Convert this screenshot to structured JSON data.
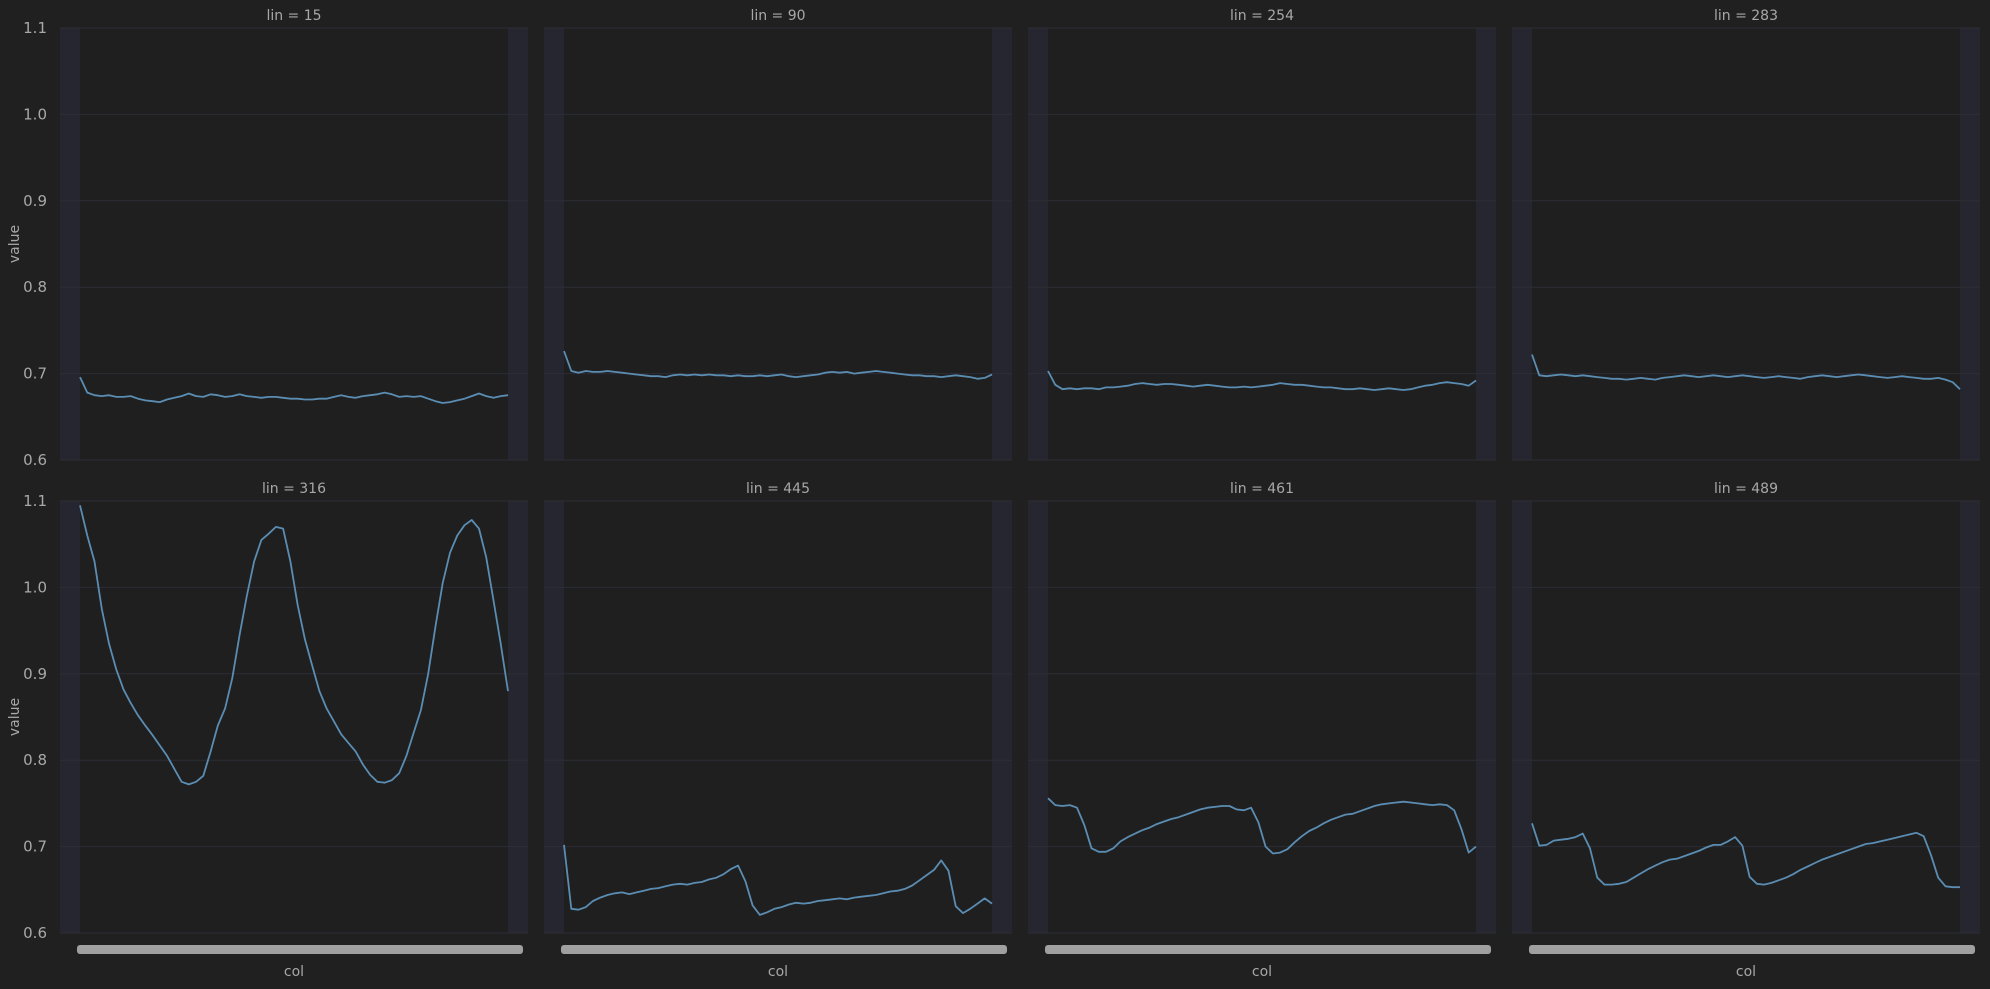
{
  "colors": {
    "background": "#202020",
    "panel": "#1f1f1f",
    "band": "#262630",
    "grid": "#2d2d36",
    "line": "#5b8db3",
    "text": "#a8a8a8",
    "xtick_overlap": "#a0a0a0"
  },
  "chart_data": {
    "type": "line",
    "layout": "facet grid, 2 rows x 4 columns, shared y axis",
    "xlabel": "col",
    "ylabel": "value",
    "ylim": [
      0.6,
      1.1
    ],
    "yticks": [
      "0.6",
      "0.7",
      "0.8",
      "0.9",
      "1.0",
      "1.1"
    ],
    "x_range": [
      0,
      1
    ],
    "x_ticks_note": "x tick labels are so dense they overlap into a solid grey band",
    "grid": true,
    "panels": [
      {
        "title": "lin = 15",
        "y": [
          0.696,
          0.678,
          0.675,
          0.674,
          0.675,
          0.673,
          0.673,
          0.674,
          0.671,
          0.669,
          0.668,
          0.667,
          0.67,
          0.672,
          0.674,
          0.677,
          0.674,
          0.673,
          0.676,
          0.675,
          0.673,
          0.674,
          0.676,
          0.674,
          0.673,
          0.672,
          0.673,
          0.673,
          0.672,
          0.671,
          0.671,
          0.67,
          0.67,
          0.671,
          0.671,
          0.673,
          0.675,
          0.673,
          0.672,
          0.674,
          0.675,
          0.676,
          0.678,
          0.676,
          0.673,
          0.674,
          0.673,
          0.674,
          0.671,
          0.668,
          0.666,
          0.667,
          0.669,
          0.671,
          0.674,
          0.677,
          0.674,
          0.672,
          0.674,
          0.675
        ]
      },
      {
        "title": "lin = 90",
        "y": [
          0.726,
          0.703,
          0.701,
          0.703,
          0.702,
          0.702,
          0.703,
          0.702,
          0.701,
          0.7,
          0.699,
          0.698,
          0.697,
          0.697,
          0.696,
          0.698,
          0.699,
          0.698,
          0.699,
          0.698,
          0.699,
          0.698,
          0.698,
          0.697,
          0.698,
          0.697,
          0.697,
          0.698,
          0.697,
          0.698,
          0.699,
          0.697,
          0.696,
          0.697,
          0.698,
          0.699,
          0.701,
          0.702,
          0.701,
          0.702,
          0.7,
          0.701,
          0.702,
          0.703,
          0.702,
          0.701,
          0.7,
          0.699,
          0.698,
          0.698,
          0.697,
          0.697,
          0.696,
          0.697,
          0.698,
          0.697,
          0.696,
          0.694,
          0.695,
          0.699
        ]
      },
      {
        "title": "lin = 254",
        "y": [
          0.703,
          0.687,
          0.682,
          0.683,
          0.682,
          0.683,
          0.683,
          0.682,
          0.684,
          0.684,
          0.685,
          0.686,
          0.688,
          0.689,
          0.688,
          0.687,
          0.688,
          0.688,
          0.687,
          0.686,
          0.685,
          0.686,
          0.687,
          0.686,
          0.685,
          0.684,
          0.684,
          0.685,
          0.684,
          0.685,
          0.686,
          0.687,
          0.689,
          0.688,
          0.687,
          0.687,
          0.686,
          0.685,
          0.684,
          0.684,
          0.683,
          0.682,
          0.682,
          0.683,
          0.682,
          0.681,
          0.682,
          0.683,
          0.682,
          0.681,
          0.682,
          0.684,
          0.686,
          0.687,
          0.689,
          0.69,
          0.689,
          0.688,
          0.686,
          0.692
        ]
      },
      {
        "title": "lin = 283",
        "y": [
          0.722,
          0.698,
          0.697,
          0.698,
          0.699,
          0.698,
          0.697,
          0.698,
          0.697,
          0.696,
          0.695,
          0.694,
          0.694,
          0.693,
          0.694,
          0.695,
          0.694,
          0.693,
          0.695,
          0.696,
          0.697,
          0.698,
          0.697,
          0.696,
          0.697,
          0.698,
          0.697,
          0.696,
          0.697,
          0.698,
          0.697,
          0.696,
          0.695,
          0.696,
          0.697,
          0.696,
          0.695,
          0.694,
          0.696,
          0.697,
          0.698,
          0.697,
          0.696,
          0.697,
          0.698,
          0.699,
          0.698,
          0.697,
          0.696,
          0.695,
          0.696,
          0.697,
          0.696,
          0.695,
          0.694,
          0.694,
          0.695,
          0.693,
          0.69,
          0.682
        ]
      },
      {
        "title": "lin = 316",
        "y": [
          1.095,
          1.06,
          1.03,
          0.975,
          0.935,
          0.905,
          0.882,
          0.866,
          0.852,
          0.84,
          0.829,
          0.817,
          0.805,
          0.79,
          0.775,
          0.772,
          0.775,
          0.782,
          0.81,
          0.84,
          0.86,
          0.895,
          0.945,
          0.99,
          1.03,
          1.055,
          1.062,
          1.07,
          1.068,
          1.03,
          0.98,
          0.94,
          0.91,
          0.88,
          0.86,
          0.845,
          0.83,
          0.82,
          0.81,
          0.795,
          0.783,
          0.775,
          0.774,
          0.777,
          0.785,
          0.805,
          0.832,
          0.858,
          0.9,
          0.955,
          1.005,
          1.04,
          1.06,
          1.072,
          1.078,
          1.068,
          1.035,
          0.985,
          0.935,
          0.88
        ]
      },
      {
        "title": "lin = 445",
        "y": [
          0.702,
          0.628,
          0.627,
          0.63,
          0.637,
          0.641,
          0.644,
          0.646,
          0.647,
          0.645,
          0.647,
          0.649,
          0.651,
          0.652,
          0.654,
          0.656,
          0.657,
          0.656,
          0.658,
          0.659,
          0.662,
          0.664,
          0.668,
          0.674,
          0.678,
          0.66,
          0.632,
          0.621,
          0.624,
          0.628,
          0.63,
          0.633,
          0.635,
          0.634,
          0.635,
          0.637,
          0.638,
          0.639,
          0.64,
          0.639,
          0.641,
          0.642,
          0.643,
          0.644,
          0.646,
          0.648,
          0.649,
          0.651,
          0.655,
          0.661,
          0.667,
          0.673,
          0.684,
          0.672,
          0.631,
          0.623,
          0.628,
          0.634,
          0.64,
          0.634
        ]
      },
      {
        "title": "lin = 461",
        "y": [
          0.756,
          0.748,
          0.747,
          0.748,
          0.745,
          0.725,
          0.698,
          0.694,
          0.694,
          0.698,
          0.706,
          0.711,
          0.715,
          0.719,
          0.722,
          0.726,
          0.729,
          0.732,
          0.734,
          0.737,
          0.74,
          0.743,
          0.745,
          0.746,
          0.747,
          0.747,
          0.743,
          0.742,
          0.745,
          0.728,
          0.7,
          0.692,
          0.693,
          0.697,
          0.705,
          0.712,
          0.718,
          0.722,
          0.727,
          0.731,
          0.734,
          0.737,
          0.738,
          0.741,
          0.744,
          0.747,
          0.749,
          0.75,
          0.751,
          0.752,
          0.751,
          0.75,
          0.749,
          0.748,
          0.749,
          0.748,
          0.742,
          0.72,
          0.693,
          0.7
        ]
      },
      {
        "title": "lin = 489",
        "y": [
          0.727,
          0.701,
          0.702,
          0.707,
          0.708,
          0.709,
          0.711,
          0.715,
          0.698,
          0.664,
          0.656,
          0.656,
          0.657,
          0.659,
          0.664,
          0.669,
          0.674,
          0.678,
          0.682,
          0.685,
          0.686,
          0.689,
          0.692,
          0.695,
          0.699,
          0.702,
          0.702,
          0.706,
          0.711,
          0.701,
          0.665,
          0.657,
          0.656,
          0.658,
          0.661,
          0.664,
          0.668,
          0.673,
          0.677,
          0.681,
          0.685,
          0.688,
          0.691,
          0.694,
          0.697,
          0.7,
          0.703,
          0.704,
          0.706,
          0.708,
          0.71,
          0.712,
          0.714,
          0.716,
          0.712,
          0.69,
          0.664,
          0.654,
          0.653,
          0.653
        ]
      }
    ]
  }
}
